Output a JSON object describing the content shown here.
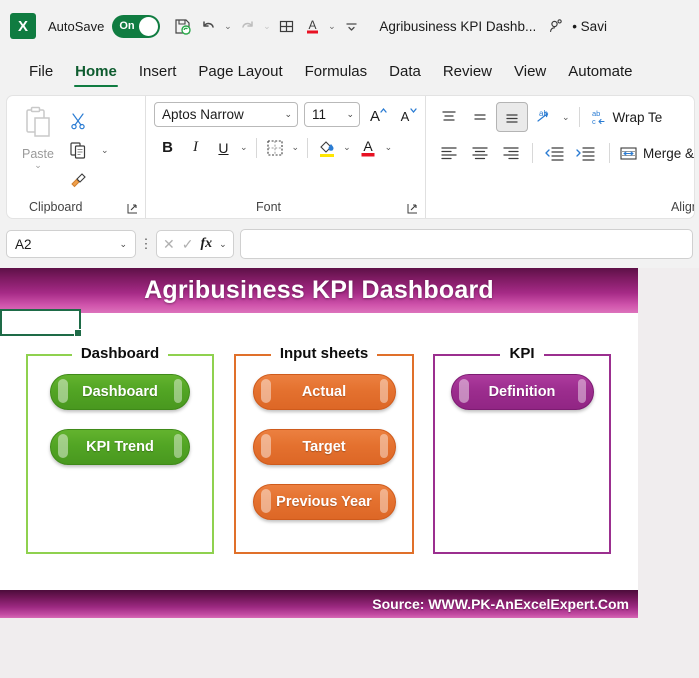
{
  "titlebar": {
    "app_icon": "excel-logo",
    "app_letter": "X",
    "autosave_label": "AutoSave",
    "autosave_state": "On",
    "document_title": "Agribusiness KPI Dashb...",
    "save_status": "• Savi",
    "quick_access": [
      {
        "name": "save-icon",
        "glyph": "὚B"
      },
      {
        "name": "undo-icon",
        "glyph": "↶"
      },
      {
        "name": "redo-icon",
        "glyph": "↷"
      },
      {
        "name": "table-icon",
        "glyph": "⊞"
      },
      {
        "name": "font-color-icon",
        "glyph": "A"
      },
      {
        "name": "customize-quick-access-icon",
        "glyph": "⌄"
      }
    ]
  },
  "ribbon_tabs": [
    {
      "label": "File",
      "active": false
    },
    {
      "label": "Home",
      "active": true
    },
    {
      "label": "Insert",
      "active": false
    },
    {
      "label": "Page Layout",
      "active": false
    },
    {
      "label": "Formulas",
      "active": false
    },
    {
      "label": "Data",
      "active": false
    },
    {
      "label": "Review",
      "active": false
    },
    {
      "label": "View",
      "active": false
    },
    {
      "label": "Automate",
      "active": false
    }
  ],
  "ribbon": {
    "clipboard": {
      "group_label": "Clipboard",
      "paste_label": "Paste",
      "cut_icon": "scissors-icon",
      "copy_icon": "copy-icon",
      "format_painter_icon": "format-painter-icon"
    },
    "font": {
      "group_label": "Font",
      "font_name": "Aptos Narrow",
      "font_size": "11",
      "bold": "B",
      "italic": "I",
      "underline": "U",
      "grow_font": "A",
      "shrink_font": "A",
      "borders_icon": "borders-icon",
      "fill_color_icon": "fill-color-icon",
      "font_color_icon": "font-color-icon",
      "font_color_letter": "A"
    },
    "alignment": {
      "group_label": "Alignment",
      "wrap_text_label": "Wrap Te",
      "merge_label": "Merge &",
      "orientation_icon": "orientation-icon"
    }
  },
  "formula_bar": {
    "name_box": "A2",
    "cancel_icon": "cancel-icon",
    "enter_icon": "enter-icon",
    "fx_label": "fx",
    "formula_value": ""
  },
  "dashboard": {
    "banner_title": "Agribusiness KPI Dashboard",
    "footer_source": "Source: WWW.PK-AnExcelExpert.Com",
    "selected_cell": "A2",
    "panels": [
      {
        "title": "Dashboard",
        "color": "#8fd14f",
        "style": "green",
        "buttons": [
          {
            "label": "Dashboard"
          },
          {
            "label": "KPI Trend"
          }
        ]
      },
      {
        "title": "Input sheets",
        "color": "#e0702a",
        "style": "orange",
        "buttons": [
          {
            "label": "Actual"
          },
          {
            "label": "Target"
          },
          {
            "label": "Previous Year"
          }
        ]
      },
      {
        "title": "KPI",
        "color": "#9b2f8f",
        "style": "purple",
        "buttons": [
          {
            "label": "Definition"
          }
        ]
      }
    ]
  },
  "colors": {
    "excel_green": "#107c41",
    "banner_top": "#5d1047",
    "banner_bottom": "#dd73bc",
    "green_button": "#52a524",
    "orange_button": "#e4712f",
    "purple_button": "#9c2d8e"
  }
}
